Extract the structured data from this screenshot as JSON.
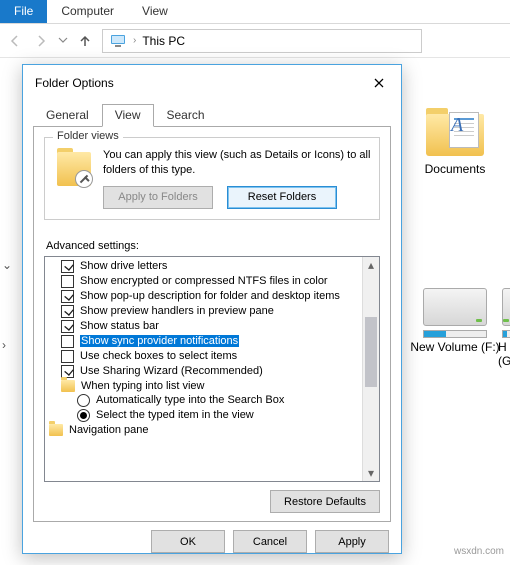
{
  "ribbon": {
    "file": "File",
    "computer": "Computer",
    "view": "View"
  },
  "nav": {
    "location": "This PC"
  },
  "bg": {
    "documents": "Documents",
    "volume_f": "New Volume (F:)",
    "volume_g1": "H",
    "volume_g2": "(G"
  },
  "dialog": {
    "title": "Folder Options",
    "tabs": {
      "general": "General",
      "view": "View",
      "search": "Search"
    },
    "folder_views": {
      "legend": "Folder views",
      "text": "You can apply this view (such as Details or Icons) to all folders of this type.",
      "apply": "Apply to Folders",
      "reset": "Reset Folders"
    },
    "advanced_label": "Advanced settings:",
    "items": {
      "drive_letters": "Show drive letters",
      "encrypted": "Show encrypted or compressed NTFS files in color",
      "popup": "Show pop-up description for folder and desktop items",
      "preview": "Show preview handlers in preview pane",
      "status": "Show status bar",
      "sync": "Show sync provider notifications",
      "checkboxes": "Use check boxes to select items",
      "sharing": "Use Sharing Wizard (Recommended)",
      "typing_header": "When typing into list view",
      "auto_type": "Automatically type into the Search Box",
      "select_typed": "Select the typed item in the view",
      "nav_pane": "Navigation pane"
    },
    "restore": "Restore Defaults",
    "ok": "OK",
    "cancel": "Cancel",
    "apply_btn": "Apply"
  },
  "watermark": "wsxdn.com"
}
